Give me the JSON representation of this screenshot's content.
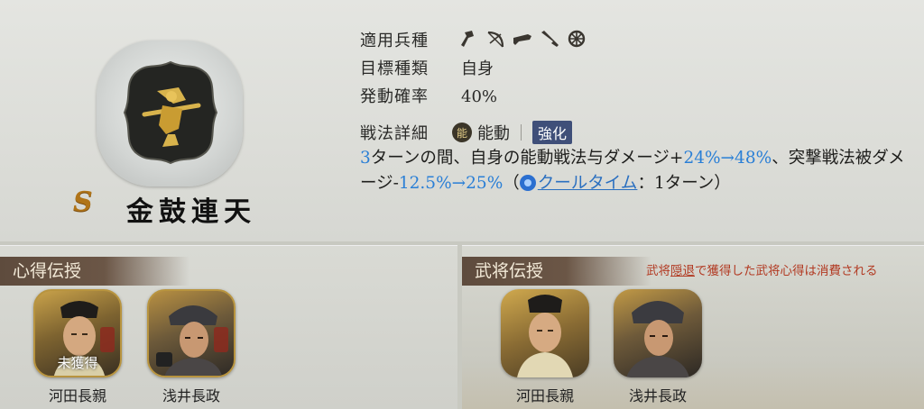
{
  "skill": {
    "rank": "S",
    "name": "金鼓連天",
    "emblem_icon": "taiko-drummer-emblem-icon"
  },
  "info": {
    "troop_label": "適用兵種",
    "troop_icons": [
      "spear-icon",
      "bow-icon",
      "rifle-icon",
      "cavalry-icon",
      "siege-icon"
    ],
    "target_label": "目標種類",
    "target_value": "自身",
    "chance_label": "発動確率",
    "chance_value": "40%"
  },
  "detail": {
    "label": "戦法詳細",
    "type_icon": "能",
    "type": "能動",
    "enhance": "強化",
    "desc_p1_num": "3",
    "desc_p1": "ターンの間、自身の能動戦法与ダメージ+",
    "desc_p1_up": "24%→48%",
    "desc_p2": "、突撃戦法被ダメージ-",
    "desc_p2_down": "12.5%→25%",
    "desc_paren_open": "（",
    "cooldown_link": "クールタイム",
    "cooldown_rest": "：1ターン）"
  },
  "left_panel": {
    "title": "心得伝授",
    "generals": [
      {
        "name": "河田長親",
        "status": "未獲得"
      },
      {
        "name": "浅井長政",
        "status": ""
      }
    ]
  },
  "right_panel": {
    "title": "武将伝授",
    "notice_pre": "武将",
    "notice_link": "隠退",
    "notice_post": "で獲得した武将心得は消費される",
    "generals": [
      {
        "name": "河田長親"
      },
      {
        "name": "浅井長政"
      }
    ]
  },
  "colors": {
    "accent_blue": "#2a7fd6",
    "rank_gold": "#b07418",
    "notice_red": "#b23a22",
    "panel_header": "#5e4b3d"
  }
}
